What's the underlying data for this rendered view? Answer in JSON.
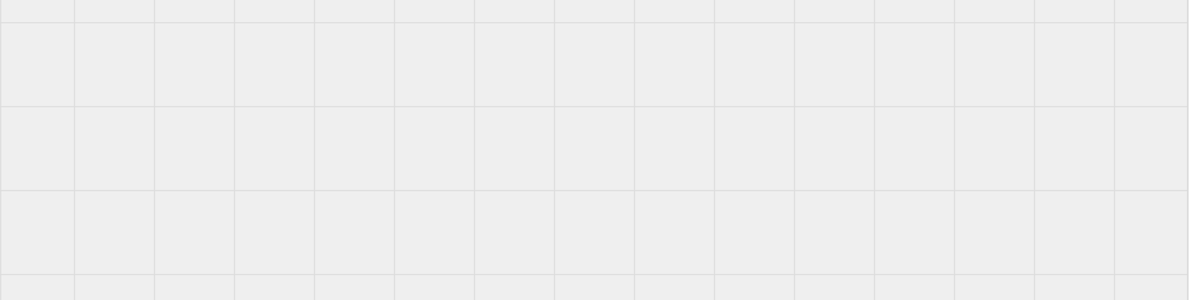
{
  "canvas": {
    "background_color": "#efefef",
    "page_color": "#ffffff",
    "grid_line_color": "#dcdcdc",
    "border_color": "#d6d6d6",
    "grid_visible": true
  }
}
